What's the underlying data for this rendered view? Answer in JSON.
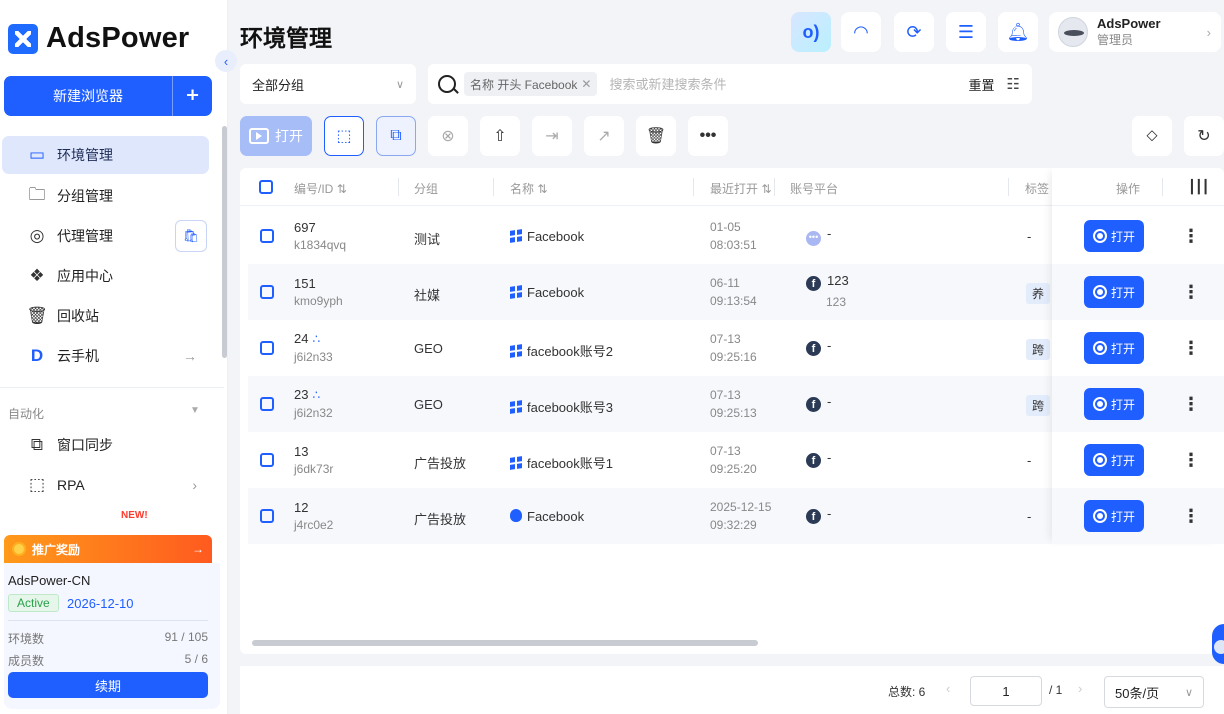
{
  "app": {
    "logo_text": "AdsPower",
    "new_browser_label": "新建浏览器"
  },
  "sidebar": {
    "items": [
      {
        "label": "环境管理",
        "icon": "browser-window-icon",
        "active": true
      },
      {
        "label": "分组管理",
        "icon": "folder-icon"
      },
      {
        "label": "代理管理",
        "icon": "globe-icon"
      },
      {
        "label": "应用中心",
        "icon": "puzzle-icon"
      },
      {
        "label": "回收站",
        "icon": "trash-icon"
      },
      {
        "label": "云手机",
        "icon": "cloud-phone-icon"
      }
    ],
    "section_label": "自动化",
    "automation": [
      {
        "label": "窗口同步",
        "icon": "sync-icon"
      },
      {
        "label": "RPA",
        "icon": "robot-icon"
      }
    ],
    "new_tag": "NEW!"
  },
  "promo": {
    "label": "推广奖励"
  },
  "account": {
    "name": "AdsPower-CN",
    "status": "Active",
    "expiry": "2026-12-10",
    "env_label": "环境数",
    "env_value": "91 / 105",
    "member_label": "成员数",
    "member_value": "5 / 6",
    "renew_label": "续期"
  },
  "header": {
    "title": "环境管理",
    "user_name": "AdsPower",
    "user_role": "管理员"
  },
  "filter": {
    "group_select": "全部分组",
    "chip_label": "名称 开头 Facebook",
    "search_placeholder": "搜索或新建搜索条件",
    "reset_label": "重置"
  },
  "toolbar": {
    "open_label": "打开"
  },
  "table": {
    "headers": {
      "id": "编号/ID",
      "group": "分组",
      "name": "名称",
      "last_open": "最近打开",
      "platform": "账号平台",
      "tags": "标签",
      "actions": "操作"
    },
    "rows": [
      {
        "num": "697",
        "id": "k1834qvq",
        "group": "测试",
        "name": "Facebook",
        "os": "windows",
        "date": "01-05",
        "time": "08:03:51",
        "platform_icon": "more",
        "account": "-",
        "account2": "",
        "tag": "-",
        "tag_pill": false,
        "shared": false
      },
      {
        "num": "151",
        "id": "kmo9yph",
        "group": "社媒",
        "name": "Facebook",
        "os": "windows",
        "date": "06-11",
        "time": "09:13:54",
        "platform_icon": "facebook",
        "account": "123",
        "account2": "123",
        "tag": "养",
        "tag_pill": true,
        "shared": false
      },
      {
        "num": "24",
        "id": "j6i2n33",
        "group": "GEO",
        "name": "facebook账号2",
        "os": "windows",
        "date": "07-13",
        "time": "09:25:16",
        "platform_icon": "facebook",
        "account": "-",
        "account2": "",
        "tag": "跨",
        "tag_pill": true,
        "shared": true
      },
      {
        "num": "23",
        "id": "j6i2n32",
        "group": "GEO",
        "name": "facebook账号3",
        "os": "windows",
        "date": "07-13",
        "time": "09:25:13",
        "platform_icon": "facebook",
        "account": "-",
        "account2": "",
        "tag": "跨",
        "tag_pill": true,
        "shared": true
      },
      {
        "num": "13",
        "id": "j6dk73r",
        "group": "广告投放",
        "name": "facebook账号1",
        "os": "windows",
        "date": "07-13",
        "time": "09:25:20",
        "platform_icon": "facebook",
        "account": "-",
        "account2": "",
        "tag": "-",
        "tag_pill": false,
        "shared": false
      },
      {
        "num": "12",
        "id": "j4rc0e2",
        "group": "广告投放",
        "name": "Facebook",
        "os": "apple",
        "date": "2025-12-15",
        "time": "09:32:29",
        "platform_icon": "facebook",
        "account": "-",
        "account2": "",
        "tag": "-",
        "tag_pill": false,
        "shared": false
      }
    ],
    "open_button": "打开"
  },
  "pagination": {
    "total": "总数: 6",
    "current": "1",
    "of": "/ 1",
    "page_size": "50条/页"
  }
}
